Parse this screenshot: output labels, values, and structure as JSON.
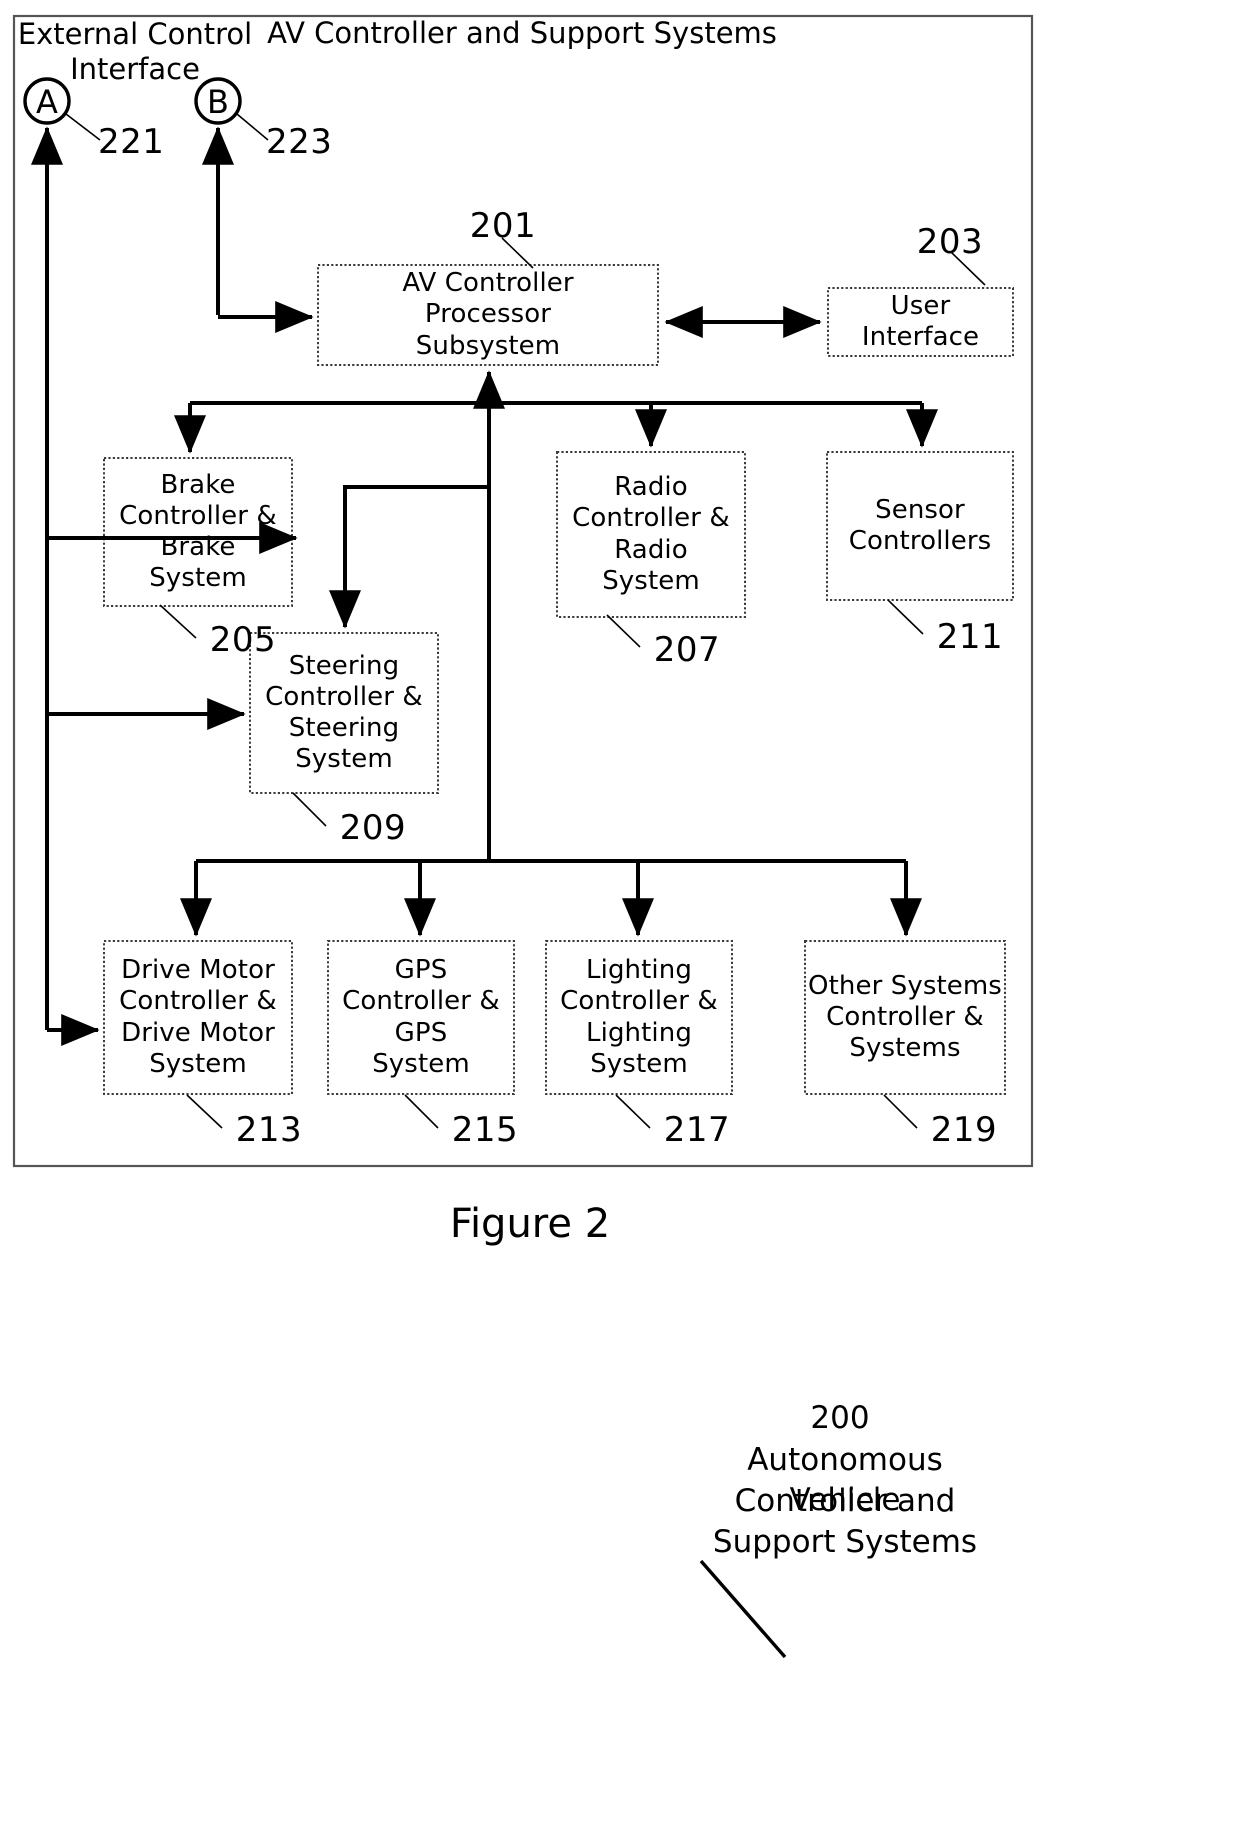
{
  "figure": {
    "caption": "Figure 2",
    "diagram_title": "AV Controller and Support Systems",
    "external_interface_label": "External Control\nInterface",
    "bottom_caption": {
      "number": "200",
      "line1": "Autonomous Vehicle",
      "line2": "Controller and",
      "line3": "Support Systems"
    },
    "colors": {
      "ink": "#000000",
      "background": "#ffffff",
      "box_border": "#404040"
    }
  },
  "connectors": {
    "circle_a": {
      "letter": "A",
      "ref": "221"
    },
    "circle_b": {
      "letter": "B",
      "ref": "223"
    }
  },
  "blocks": [
    {
      "id": "proc",
      "label": "AV Controller\nProcessor\nSubsystem",
      "ref": "201"
    },
    {
      "id": "ui",
      "label": "User\nInterface",
      "ref": "203"
    },
    {
      "id": "brake",
      "label": "Brake\nController &\nBrake\nSystem",
      "ref": "205"
    },
    {
      "id": "radio",
      "label": "Radio\nController &\nRadio\nSystem",
      "ref": "207"
    },
    {
      "id": "steering",
      "label": "Steering\nController &\nSteering\nSystem",
      "ref": "209"
    },
    {
      "id": "sensor",
      "label": "Sensor\nControllers",
      "ref": "211"
    },
    {
      "id": "drive",
      "label": "Drive Motor\nController &\nDrive Motor\nSystem",
      "ref": "213"
    },
    {
      "id": "gps",
      "label": "GPS\nController &\nGPS\nSystem",
      "ref": "215"
    },
    {
      "id": "lighting",
      "label": "Lighting\nController &\nLighting\nSystem",
      "ref": "217"
    },
    {
      "id": "other",
      "label": "Other Systems\nController &\nSystems",
      "ref": "219"
    }
  ]
}
